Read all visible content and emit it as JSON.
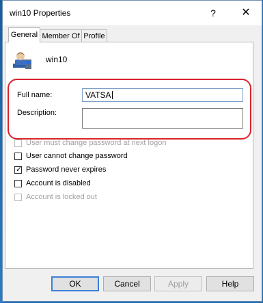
{
  "window": {
    "title": "win10 Properties",
    "help_glyph": "?",
    "close_glyph": "✕"
  },
  "tabs": [
    {
      "label": "General",
      "active": true
    },
    {
      "label": "Member Of",
      "active": false
    },
    {
      "label": "Profile",
      "active": false
    }
  ],
  "user": {
    "name": "win10",
    "icon": "user-icon"
  },
  "form": {
    "full_name_label": "Full name:",
    "full_name_value": "VATSA",
    "description_label": "Description:",
    "description_value": ""
  },
  "options": [
    {
      "label": "User must change password at next logon",
      "checked": false,
      "enabled": false
    },
    {
      "label": "User cannot change password",
      "checked": false,
      "enabled": true
    },
    {
      "label": "Password never expires",
      "checked": true,
      "enabled": true
    },
    {
      "label": "Account is disabled",
      "checked": false,
      "enabled": true
    },
    {
      "label": "Account is locked out",
      "checked": false,
      "enabled": false
    }
  ],
  "buttons": {
    "ok": "OK",
    "cancel": "Cancel",
    "apply": "Apply",
    "help": "Help"
  },
  "colors": {
    "highlight": "#d9232d",
    "accent": "#3c7fd6"
  }
}
